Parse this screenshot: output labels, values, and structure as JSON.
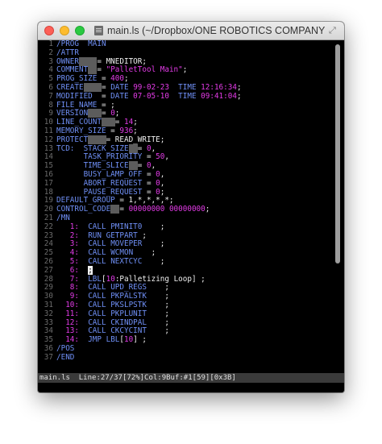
{
  "window": {
    "title": "main.ls (~/Dropbox/ONE ROBOTICS COMPANY/c....."
  },
  "lines": [
    {
      "n": "1",
      "t": [
        [
          "/PROG  MAIN",
          "kw"
        ]
      ]
    },
    {
      "n": "2",
      "t": [
        [
          "/ATTR",
          "kw"
        ]
      ]
    },
    {
      "n": "3",
      "t": [
        [
          "OWNER",
          "kw"
        ],
        [
          "    ",
          "sel"
        ],
        [
          "= MNEDITOR;",
          "wh"
        ]
      ]
    },
    {
      "n": "4",
      "t": [
        [
          "COMMENT",
          "kw"
        ],
        [
          "  ",
          "sel"
        ],
        [
          "= ",
          "wh"
        ],
        [
          "\"PalletTool Main\"",
          "mg"
        ],
        [
          ";",
          "wh"
        ]
      ]
    },
    {
      "n": "5",
      "t": [
        [
          "PROG_SIZE",
          "kw"
        ],
        [
          " = ",
          "wh"
        ],
        [
          "400",
          "mg"
        ],
        [
          ";",
          "wh"
        ]
      ]
    },
    {
      "n": "6",
      "t": [
        [
          "CREATE",
          "kw"
        ],
        [
          "    ",
          "sel"
        ],
        [
          "= ",
          "wh"
        ],
        [
          "DATE ",
          "kw"
        ],
        [
          "99-02-23",
          "mg"
        ],
        [
          "  ",
          "wh"
        ],
        [
          "TIME ",
          "kw"
        ],
        [
          "12:16:34",
          "mg"
        ],
        [
          ";",
          "wh"
        ]
      ]
    },
    {
      "n": "7",
      "t": [
        [
          "MODIFIED",
          "kw"
        ],
        [
          "  = ",
          "wh"
        ],
        [
          "DATE ",
          "kw"
        ],
        [
          "07-05-10",
          "mg"
        ],
        [
          "  ",
          "wh"
        ],
        [
          "TIME ",
          "kw"
        ],
        [
          "09:41:04",
          "mg"
        ],
        [
          ";",
          "wh"
        ]
      ]
    },
    {
      "n": "8",
      "t": [
        [
          "FILE_NAME",
          "kw"
        ],
        [
          " = ;",
          "wh"
        ]
      ]
    },
    {
      "n": "9",
      "t": [
        [
          "VERSION",
          "kw"
        ],
        [
          "   ",
          "sel"
        ],
        [
          "= ",
          "wh"
        ],
        [
          "0",
          "mg"
        ],
        [
          ";",
          "wh"
        ]
      ]
    },
    {
      "n": "10",
      "t": [
        [
          "LINE_COUNT",
          "kw"
        ],
        [
          "   ",
          "sel"
        ],
        [
          "= ",
          "wh"
        ],
        [
          "14",
          "mg"
        ],
        [
          ";",
          "wh"
        ]
      ]
    },
    {
      "n": "11",
      "t": [
        [
          "MEMORY_SIZE",
          "kw"
        ],
        [
          " = ",
          "wh"
        ],
        [
          "936",
          "mg"
        ],
        [
          ";",
          "wh"
        ]
      ]
    },
    {
      "n": "12",
      "t": [
        [
          "PROTECT",
          "kw"
        ],
        [
          "    ",
          "sel"
        ],
        [
          "= READ_WRITE;",
          "wh"
        ]
      ]
    },
    {
      "n": "13",
      "t": [
        [
          "TCD:  STACK_SIZE",
          "kw"
        ],
        [
          "  ",
          "sel"
        ],
        [
          "= ",
          "wh"
        ],
        [
          "0",
          "mg"
        ],
        [
          ",",
          "wh"
        ]
      ]
    },
    {
      "n": "14",
      "t": [
        [
          "      TASK_PRIORITY",
          "kw"
        ],
        [
          " = ",
          "wh"
        ],
        [
          "50",
          "mg"
        ],
        [
          ",",
          "wh"
        ]
      ]
    },
    {
      "n": "15",
      "t": [
        [
          "      TIME_SLICE",
          "kw"
        ],
        [
          "  ",
          "sel"
        ],
        [
          "= ",
          "wh"
        ],
        [
          "0",
          "mg"
        ],
        [
          ",",
          "wh"
        ]
      ]
    },
    {
      "n": "16",
      "t": [
        [
          "      BUSY_LAMP_OFF",
          "kw"
        ],
        [
          " = ",
          "wh"
        ],
        [
          "0",
          "mg"
        ],
        [
          ",",
          "wh"
        ]
      ]
    },
    {
      "n": "17",
      "t": [
        [
          "      ABORT_REQUEST",
          "kw"
        ],
        [
          " = ",
          "wh"
        ],
        [
          "0",
          "mg"
        ],
        [
          ",",
          "wh"
        ]
      ]
    },
    {
      "n": "18",
      "t": [
        [
          "      PAUSE_REQUEST",
          "kw"
        ],
        [
          " = ",
          "wh"
        ],
        [
          "0",
          "mg"
        ],
        [
          ";",
          "wh"
        ]
      ]
    },
    {
      "n": "19",
      "t": [
        [
          "DEFAULT_GROUP",
          "kw"
        ],
        [
          " = 1,*,*,*,*;",
          "wh"
        ]
      ]
    },
    {
      "n": "20",
      "t": [
        [
          "CONTROL_CODE",
          "kw"
        ],
        [
          "  ",
          "sel"
        ],
        [
          "= ",
          "wh"
        ],
        [
          "00000000 00000000",
          "mg"
        ],
        [
          ";",
          "wh"
        ]
      ]
    },
    {
      "n": "21",
      "t": [
        [
          "/MN",
          "kw"
        ]
      ]
    },
    {
      "n": "22",
      "t": [
        [
          "   ",
          "wh"
        ],
        [
          "1:",
          "mg"
        ],
        [
          "  ",
          "wh"
        ],
        [
          "CALL PMINIT0",
          "kw"
        ],
        [
          "    ;",
          "wh"
        ]
      ]
    },
    {
      "n": "23",
      "t": [
        [
          "   ",
          "wh"
        ],
        [
          "2:",
          "mg"
        ],
        [
          "  ",
          "wh"
        ],
        [
          "RUN GETPART",
          "kw"
        ],
        [
          " ;",
          "wh"
        ]
      ]
    },
    {
      "n": "24",
      "t": [
        [
          "   ",
          "wh"
        ],
        [
          "3:",
          "mg"
        ],
        [
          "  ",
          "wh"
        ],
        [
          "CALL MOVEPER",
          "kw"
        ],
        [
          "    ;",
          "wh"
        ]
      ]
    },
    {
      "n": "25",
      "t": [
        [
          "   ",
          "wh"
        ],
        [
          "4:",
          "mg"
        ],
        [
          "  ",
          "wh"
        ],
        [
          "CALL WCMON",
          "kw"
        ],
        [
          "    ;",
          "wh"
        ]
      ]
    },
    {
      "n": "26",
      "t": [
        [
          "   ",
          "wh"
        ],
        [
          "5:",
          "mg"
        ],
        [
          "  ",
          "wh"
        ],
        [
          "CALL NEXTCYC",
          "kw"
        ],
        [
          "    ;",
          "wh"
        ]
      ]
    },
    {
      "n": "27",
      "t": [
        [
          "   ",
          "wh"
        ],
        [
          "6:",
          "mg"
        ],
        [
          "  ",
          "wh"
        ],
        [
          ";",
          "cursor"
        ]
      ]
    },
    {
      "n": "28",
      "t": [
        [
          "   ",
          "wh"
        ],
        [
          "7:",
          "mg"
        ],
        [
          "  ",
          "wh"
        ],
        [
          "LBL",
          "kw"
        ],
        [
          "[",
          "wh"
        ],
        [
          "10",
          "mg"
        ],
        [
          ":",
          "wh"
        ],
        [
          "Palletizing Loop",
          "wh"
        ],
        [
          "] ;",
          "wh"
        ]
      ]
    },
    {
      "n": "29",
      "t": [
        [
          "   ",
          "wh"
        ],
        [
          "8:",
          "mg"
        ],
        [
          "  ",
          "wh"
        ],
        [
          "CALL UPD_REGS",
          "kw"
        ],
        [
          "    ;",
          "wh"
        ]
      ]
    },
    {
      "n": "30",
      "t": [
        [
          "   ",
          "wh"
        ],
        [
          "9:",
          "mg"
        ],
        [
          "  ",
          "wh"
        ],
        [
          "CALL PKPALSTK",
          "kw"
        ],
        [
          "    ;",
          "wh"
        ]
      ]
    },
    {
      "n": "31",
      "t": [
        [
          "  ",
          "wh"
        ],
        [
          "10:",
          "mg"
        ],
        [
          "  ",
          "wh"
        ],
        [
          "CALL PKSLPSTK",
          "kw"
        ],
        [
          "    ;",
          "wh"
        ]
      ]
    },
    {
      "n": "32",
      "t": [
        [
          "  ",
          "wh"
        ],
        [
          "11:",
          "mg"
        ],
        [
          "  ",
          "wh"
        ],
        [
          "CALL PKPLUNIT",
          "kw"
        ],
        [
          "    ;",
          "wh"
        ]
      ]
    },
    {
      "n": "33",
      "t": [
        [
          "  ",
          "wh"
        ],
        [
          "12:",
          "mg"
        ],
        [
          "  ",
          "wh"
        ],
        [
          "CALL CKINDPAL",
          "kw"
        ],
        [
          "    ;",
          "wh"
        ]
      ]
    },
    {
      "n": "34",
      "t": [
        [
          "  ",
          "wh"
        ],
        [
          "13:",
          "mg"
        ],
        [
          "  ",
          "wh"
        ],
        [
          "CALL CKCYCINT",
          "kw"
        ],
        [
          "    ;",
          "wh"
        ]
      ]
    },
    {
      "n": "35",
      "t": [
        [
          "  ",
          "wh"
        ],
        [
          "14:",
          "mg"
        ],
        [
          "  ",
          "wh"
        ],
        [
          "JMP LBL",
          "kw"
        ],
        [
          "[",
          "wh"
        ],
        [
          "10",
          "mg"
        ],
        [
          "] ;",
          "wh"
        ]
      ]
    },
    {
      "n": "36",
      "t": [
        [
          "/POS",
          "kw"
        ]
      ]
    },
    {
      "n": "37",
      "t": [
        [
          "/END",
          "kw"
        ]
      ]
    }
  ],
  "status": {
    "text": "main.ls  Line:27/37[72%]Col:9Buf:#1[59][0x3B]"
  },
  "scrollbar": {
    "position_fraction": 0.0,
    "visible_fraction": 0.68
  }
}
